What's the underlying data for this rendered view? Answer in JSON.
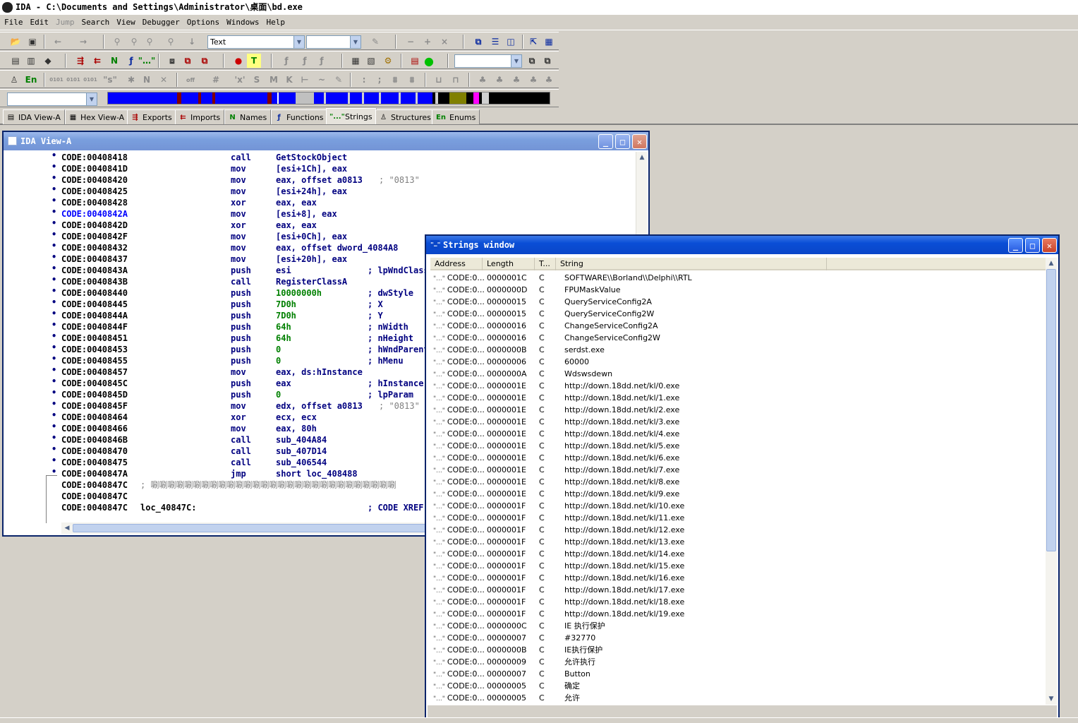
{
  "window": {
    "title": "IDA - C:\\Documents and Settings\\Administrator\\桌面\\bd.exe"
  },
  "menu": [
    "File",
    "Edit",
    "Jump",
    "Search",
    "View",
    "Debugger",
    "Options",
    "Windows",
    "Help"
  ],
  "toolbar": {
    "mode_combo": "Text",
    "search_combo": ""
  },
  "tabs": [
    {
      "label": "IDA View-A",
      "icon": "document-icon"
    },
    {
      "label": "Hex View-A",
      "icon": "hex-icon"
    },
    {
      "label": "Exports",
      "icon": "exports-icon"
    },
    {
      "label": "Imports",
      "icon": "imports-icon"
    },
    {
      "label": "Names",
      "icon": "N"
    },
    {
      "label": "Functions",
      "icon": "function-icon"
    },
    {
      "label": "Strings",
      "icon": "\"...\""
    },
    {
      "label": "Structures",
      "icon": "structure-icon"
    },
    {
      "label": "Enums",
      "icon": "En"
    }
  ],
  "ida_view": {
    "title": "IDA View-A",
    "lines": [
      {
        "addr": "CODE:00408418",
        "mn": "call",
        "op": "GetStockObject",
        "cm": ""
      },
      {
        "addr": "CODE:0040841D",
        "mn": "mov",
        "op": "[esi+1Ch], eax",
        "cm": ""
      },
      {
        "addr": "CODE:00408420",
        "mn": "mov",
        "op": "eax, offset a0813",
        "cm": "; \"0813\""
      },
      {
        "addr": "CODE:00408425",
        "mn": "mov",
        "op": "[esi+24h], eax",
        "cm": ""
      },
      {
        "addr": "CODE:00408428",
        "mn": "xor",
        "op": "eax, eax",
        "cm": ""
      },
      {
        "addr": "CODE:0040842A",
        "mn": "mov",
        "op": "[esi+8], eax",
        "cm": ""
      },
      {
        "addr": "CODE:0040842D",
        "mn": "xor",
        "op": "eax, eax",
        "cm": ""
      },
      {
        "addr": "CODE:0040842F",
        "mn": "mov",
        "op": "[esi+0Ch], eax",
        "cm": ""
      },
      {
        "addr": "CODE:00408432",
        "mn": "mov",
        "op": "eax, offset dword_4084A8",
        "cm": ""
      },
      {
        "addr": "CODE:00408437",
        "mn": "mov",
        "op": "[esi+20h], eax",
        "cm": ""
      },
      {
        "addr": "CODE:0040843A",
        "mn": "push",
        "op": "esi",
        "cm": "; lpWndClass"
      },
      {
        "addr": "CODE:0040843B",
        "mn": "call",
        "op": "RegisterClassA",
        "cm": ""
      },
      {
        "addr": "CODE:00408440",
        "mn": "push",
        "op": "10000000h",
        "cm": "; dwStyle"
      },
      {
        "addr": "CODE:00408445",
        "mn": "push",
        "op": "7D0h",
        "cm": "; X"
      },
      {
        "addr": "CODE:0040844A",
        "mn": "push",
        "op": "7D0h",
        "cm": "; Y"
      },
      {
        "addr": "CODE:0040844F",
        "mn": "push",
        "op": "64h",
        "cm": "; nWidth"
      },
      {
        "addr": "CODE:00408451",
        "mn": "push",
        "op": "64h",
        "cm": "; nHeight"
      },
      {
        "addr": "CODE:00408453",
        "mn": "push",
        "op": "0",
        "cm": "; hWndParent"
      },
      {
        "addr": "CODE:00408455",
        "mn": "push",
        "op": "0",
        "cm": "; hMenu"
      },
      {
        "addr": "CODE:00408457",
        "mn": "mov",
        "op": "eax, ds:hInstance",
        "cm": ""
      },
      {
        "addr": "CODE:0040845C",
        "mn": "push",
        "op": "eax",
        "cm": "; hInstance"
      },
      {
        "addr": "CODE:0040845D",
        "mn": "push",
        "op": "0",
        "cm": "; lpParam"
      },
      {
        "addr": "CODE:0040845F",
        "mn": "mov",
        "op": "edx, offset a0813",
        "cm": "; \"0813\""
      },
      {
        "addr": "CODE:00408464",
        "mn": "xor",
        "op": "ecx, ecx",
        "cm": ""
      },
      {
        "addr": "CODE:00408466",
        "mn": "mov",
        "op": "eax, 80h",
        "cm": ""
      },
      {
        "addr": "CODE:0040846B",
        "mn": "call",
        "op": "sub_404A84",
        "cm": ""
      },
      {
        "addr": "CODE:00408470",
        "mn": "call",
        "op": "sub_407D14",
        "cm": ""
      },
      {
        "addr": "CODE:00408475",
        "mn": "call",
        "op": "sub_406544",
        "cm": ""
      },
      {
        "addr": "CODE:0040847A",
        "mn": "jmp",
        "op": "short loc_408488",
        "cm": ""
      }
    ],
    "junk_line": {
      "addr": "CODE:0040847C",
      "text": "; 唰唰唰唰唰唰唰唰唰唰唰唰唰唰唰唰唰唰唰唰唰唰唰唰唰唰唰唰唰"
    },
    "empty_line": {
      "addr": "CODE:0040847C"
    },
    "label_line": {
      "addr": "CODE:0040847C",
      "label": "loc_40847C:",
      "cm": "; CODE XREF"
    }
  },
  "strings_window": {
    "title": "Strings window",
    "columns": [
      "Address",
      "Length",
      "T...",
      "String"
    ],
    "rows": [
      {
        "addr": "CODE:0...",
        "len": "0000001C",
        "type": "C",
        "str": "SOFTWARE\\\\Borland\\\\Delphi\\\\RTL"
      },
      {
        "addr": "CODE:0...",
        "len": "0000000D",
        "type": "C",
        "str": "FPUMaskValue"
      },
      {
        "addr": "CODE:0...",
        "len": "00000015",
        "type": "C",
        "str": "QueryServiceConfig2A"
      },
      {
        "addr": "CODE:0...",
        "len": "00000015",
        "type": "C",
        "str": "QueryServiceConfig2W"
      },
      {
        "addr": "CODE:0...",
        "len": "00000016",
        "type": "C",
        "str": "ChangeServiceConfig2A"
      },
      {
        "addr": "CODE:0...",
        "len": "00000016",
        "type": "C",
        "str": "ChangeServiceConfig2W"
      },
      {
        "addr": "CODE:0...",
        "len": "0000000B",
        "type": "C",
        "str": "serdst.exe"
      },
      {
        "addr": "CODE:0...",
        "len": "00000006",
        "type": "C",
        "str": "60000"
      },
      {
        "addr": "CODE:0...",
        "len": "0000000A",
        "type": "C",
        "str": "Wdswsdewn"
      },
      {
        "addr": "CODE:0...",
        "len": "0000001E",
        "type": "C",
        "str": "http://down.18dd.net/kl/0.exe"
      },
      {
        "addr": "CODE:0...",
        "len": "0000001E",
        "type": "C",
        "str": "http://down.18dd.net/kl/1.exe"
      },
      {
        "addr": "CODE:0...",
        "len": "0000001E",
        "type": "C",
        "str": "http://down.18dd.net/kl/2.exe"
      },
      {
        "addr": "CODE:0...",
        "len": "0000001E",
        "type": "C",
        "str": "http://down.18dd.net/kl/3.exe"
      },
      {
        "addr": "CODE:0...",
        "len": "0000001E",
        "type": "C",
        "str": "http://down.18dd.net/kl/4.exe"
      },
      {
        "addr": "CODE:0...",
        "len": "0000001E",
        "type": "C",
        "str": "http://down.18dd.net/kl/5.exe"
      },
      {
        "addr": "CODE:0...",
        "len": "0000001E",
        "type": "C",
        "str": "http://down.18dd.net/kl/6.exe"
      },
      {
        "addr": "CODE:0...",
        "len": "0000001E",
        "type": "C",
        "str": "http://down.18dd.net/kl/7.exe"
      },
      {
        "addr": "CODE:0...",
        "len": "0000001E",
        "type": "C",
        "str": "http://down.18dd.net/kl/8.exe"
      },
      {
        "addr": "CODE:0...",
        "len": "0000001E",
        "type": "C",
        "str": "http://down.18dd.net/kl/9.exe"
      },
      {
        "addr": "CODE:0...",
        "len": "0000001F",
        "type": "C",
        "str": "http://down.18dd.net/kl/10.exe"
      },
      {
        "addr": "CODE:0...",
        "len": "0000001F",
        "type": "C",
        "str": "http://down.18dd.net/kl/11.exe"
      },
      {
        "addr": "CODE:0...",
        "len": "0000001F",
        "type": "C",
        "str": "http://down.18dd.net/kl/12.exe"
      },
      {
        "addr": "CODE:0...",
        "len": "0000001F",
        "type": "C",
        "str": "http://down.18dd.net/kl/13.exe"
      },
      {
        "addr": "CODE:0...",
        "len": "0000001F",
        "type": "C",
        "str": "http://down.18dd.net/kl/14.exe"
      },
      {
        "addr": "CODE:0...",
        "len": "0000001F",
        "type": "C",
        "str": "http://down.18dd.net/kl/15.exe"
      },
      {
        "addr": "CODE:0...",
        "len": "0000001F",
        "type": "C",
        "str": "http://down.18dd.net/kl/16.exe"
      },
      {
        "addr": "CODE:0...",
        "len": "0000001F",
        "type": "C",
        "str": "http://down.18dd.net/kl/17.exe"
      },
      {
        "addr": "CODE:0...",
        "len": "0000001F",
        "type": "C",
        "str": "http://down.18dd.net/kl/18.exe"
      },
      {
        "addr": "CODE:0...",
        "len": "0000001F",
        "type": "C",
        "str": "http://down.18dd.net/kl/19.exe"
      },
      {
        "addr": "CODE:0...",
        "len": "0000000C",
        "type": "C",
        "str": "IE 执行保护"
      },
      {
        "addr": "CODE:0...",
        "len": "00000007",
        "type": "C",
        "str": "#32770"
      },
      {
        "addr": "CODE:0...",
        "len": "0000000B",
        "type": "C",
        "str": "IE执行保护"
      },
      {
        "addr": "CODE:0...",
        "len": "00000009",
        "type": "C",
        "str": "允许执行"
      },
      {
        "addr": "CODE:0...",
        "len": "00000007",
        "type": "C",
        "str": "Button"
      },
      {
        "addr": "CODE:0...",
        "len": "00000005",
        "type": "C",
        "str": "确定"
      },
      {
        "addr": "CODE:0...",
        "len": "00000005",
        "type": "C",
        "str": "允许"
      }
    ]
  },
  "colors": {
    "titlebar_blue": "#0a46c8",
    "code_navy": "#000080",
    "nav_blue": "#0000ff"
  }
}
